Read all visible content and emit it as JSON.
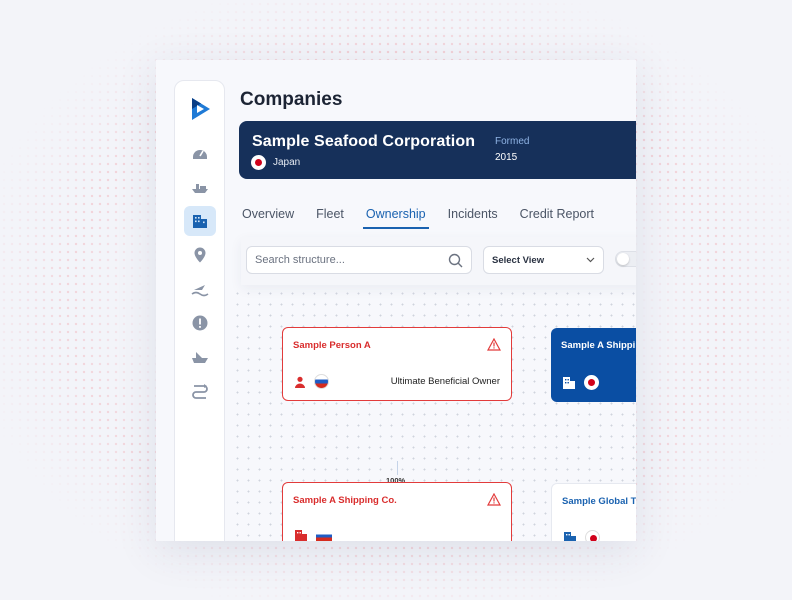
{
  "page": {
    "title": "Companies"
  },
  "sidebar": {
    "items": [
      {
        "icon": "dashboard-gauge-icon",
        "active": false
      },
      {
        "icon": "ship-icon",
        "active": false
      },
      {
        "icon": "building-icon",
        "active": true
      },
      {
        "icon": "location-pin-icon",
        "active": false
      },
      {
        "icon": "fishing-icon",
        "active": false
      },
      {
        "icon": "alert-icon",
        "active": false
      },
      {
        "icon": "vessel-icon",
        "active": false
      },
      {
        "icon": "route-icon",
        "active": false
      }
    ]
  },
  "company": {
    "name": "Sample Seafood Corporation",
    "country": "Japan",
    "formed_label": "Formed",
    "formed_value": "2015"
  },
  "tabs": [
    {
      "label": "Overview",
      "active": false
    },
    {
      "label": "Fleet",
      "active": false
    },
    {
      "label": "Ownership",
      "active": true
    },
    {
      "label": "Incidents",
      "active": false
    },
    {
      "label": "Credit Report",
      "active": false
    }
  ],
  "toolbar": {
    "search_placeholder": "Search structure...",
    "select_value": "Select View"
  },
  "structure": {
    "nodes": [
      {
        "title": "Sample Person A",
        "role": "Ultimate Beneficial Owner",
        "alert": true
      },
      {
        "title": "Sample A Shippi",
        "alert": false
      },
      {
        "title": "Sample A  Shipping Co.",
        "alert": true
      },
      {
        "title": "Sample Global T",
        "alert": false
      }
    ],
    "link_percent": "100%"
  },
  "colors": {
    "accent": "#1a62b0",
    "banner": "#16305a",
    "alert": "#d92d2d",
    "node_blue": "#0a4ea3"
  }
}
